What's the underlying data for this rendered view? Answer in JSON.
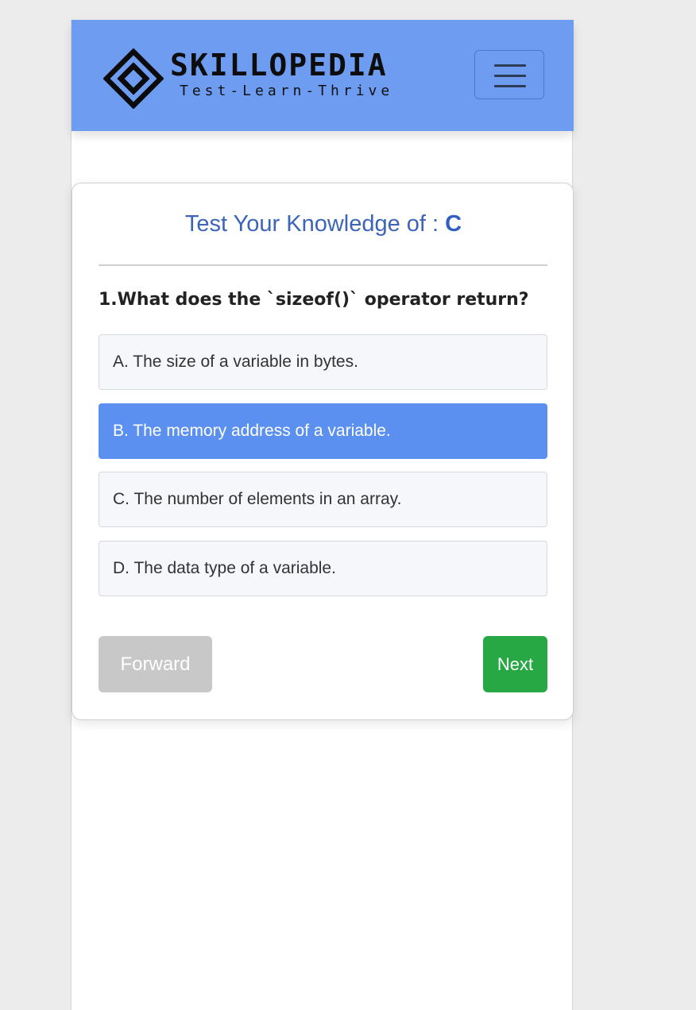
{
  "brand": {
    "name": "SKILLOPEDIA",
    "tagline": "Test-Learn-Thrive"
  },
  "colors": {
    "navbar": "#6d9cf1",
    "selected_option": "#5b90f1",
    "next_button": "#27a845",
    "forward_button": "#c8c8c8",
    "title": "#3c64b8"
  },
  "quiz": {
    "title_prefix": "Test Your Knowledge of : ",
    "subject": "C",
    "question": "1.What does the `sizeof()` operator return?",
    "options": [
      {
        "label": "A. The size of a variable in bytes.",
        "selected": false
      },
      {
        "label": "B. The memory address of a variable.",
        "selected": true
      },
      {
        "label": "C. The number of elements in an array.",
        "selected": false
      },
      {
        "label": "D. The data type of a variable.",
        "selected": false
      }
    ],
    "forward_label": "Forward",
    "next_label": "Next"
  },
  "icons": {
    "menu": "hamburger-menu-icon",
    "logo": "diamond-logo-icon"
  }
}
